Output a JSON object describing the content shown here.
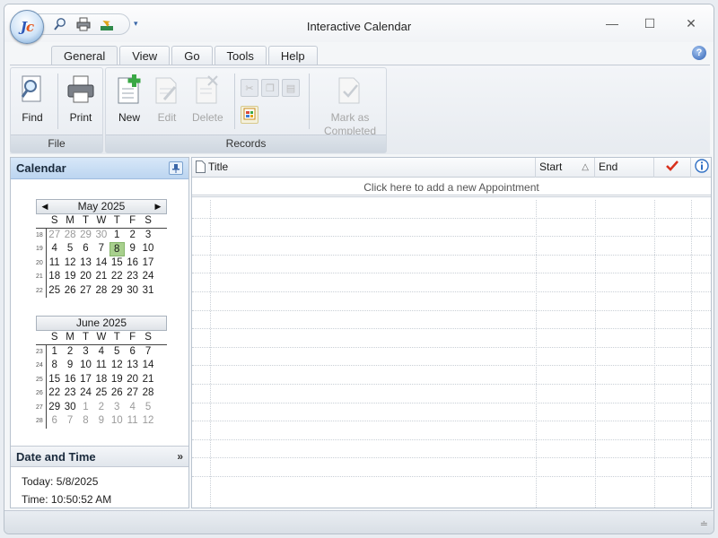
{
  "window": {
    "title": "Interactive Calendar",
    "minimize": "—",
    "maximize": "☐",
    "close": "✕"
  },
  "app_logo": {
    "letters": "J",
    "accent": "c"
  },
  "ribbon": {
    "tabs": [
      "General",
      "View",
      "Go",
      "Tools",
      "Help"
    ],
    "active_tab": "General",
    "groups": {
      "file": {
        "label": "File",
        "buttons": [
          {
            "label": "Find",
            "icon": "find-icon",
            "enabled": true
          },
          {
            "label": "Print",
            "icon": "printer-icon",
            "enabled": true
          }
        ]
      },
      "records": {
        "label": "Records",
        "buttons": [
          {
            "label": "New",
            "icon": "new-document-icon",
            "enabled": true
          },
          {
            "label": "Edit",
            "icon": "edit-document-icon",
            "enabled": false
          },
          {
            "label": "Delete",
            "icon": "delete-document-icon",
            "enabled": false
          },
          {
            "label": "Mark as\nCompleted",
            "label_line1": "Mark as",
            "label_line2": "Completed",
            "icon": "mark-completed-icon",
            "enabled": false
          }
        ]
      }
    }
  },
  "calendar_pane": {
    "title": "Calendar",
    "dow": [
      "S",
      "M",
      "T",
      "W",
      "T",
      "F",
      "S"
    ],
    "months": [
      {
        "title": "May 2025",
        "weeks": [
          {
            "num": "18",
            "days": [
              "27",
              "28",
              "29",
              "30",
              "1",
              "2",
              "3"
            ]
          },
          {
            "num": "19",
            "days": [
              "4",
              "5",
              "6",
              "7",
              "8",
              "9",
              "10"
            ]
          },
          {
            "num": "20",
            "days": [
              "11",
              "12",
              "13",
              "14",
              "15",
              "16",
              "17"
            ]
          },
          {
            "num": "21",
            "days": [
              "18",
              "19",
              "20",
              "21",
              "22",
              "23",
              "24"
            ]
          },
          {
            "num": "22",
            "days": [
              "25",
              "26",
              "27",
              "28",
              "29",
              "30",
              "31"
            ]
          }
        ]
      },
      {
        "title": "June 2025",
        "weeks": [
          {
            "num": "23",
            "days": [
              "1",
              "2",
              "3",
              "4",
              "5",
              "6",
              "7"
            ]
          },
          {
            "num": "24",
            "days": [
              "8",
              "9",
              "10",
              "11",
              "12",
              "13",
              "14"
            ]
          },
          {
            "num": "25",
            "days": [
              "15",
              "16",
              "17",
              "18",
              "19",
              "20",
              "21"
            ]
          },
          {
            "num": "26",
            "days": [
              "22",
              "23",
              "24",
              "25",
              "26",
              "27",
              "28"
            ]
          },
          {
            "num": "27",
            "days": [
              "29",
              "30",
              "1",
              "2",
              "3",
              "4",
              "5"
            ]
          },
          {
            "num": "28",
            "days": [
              "6",
              "7",
              "8",
              "9",
              "10",
              "11",
              "12"
            ]
          }
        ]
      }
    ],
    "today_day": "8"
  },
  "datetime_pane": {
    "title": "Date and Time",
    "today": "Today: 5/8/2025",
    "time": "Time: 10:50:52 AM"
  },
  "grid": {
    "columns": [
      {
        "label": "Title",
        "icon": "document-icon"
      },
      {
        "label": "Start",
        "sort": "△"
      },
      {
        "label": "End"
      },
      {
        "label": "",
        "icon": "checkmark-icon"
      },
      {
        "label": "",
        "icon": "info-icon"
      }
    ],
    "add_prompt": "Click here to add a new Appointment",
    "empty_rows": 15
  },
  "colors": {
    "accent": "#3a7bd5",
    "today_highlight": "#a8d08d",
    "check": "#d9301c"
  }
}
